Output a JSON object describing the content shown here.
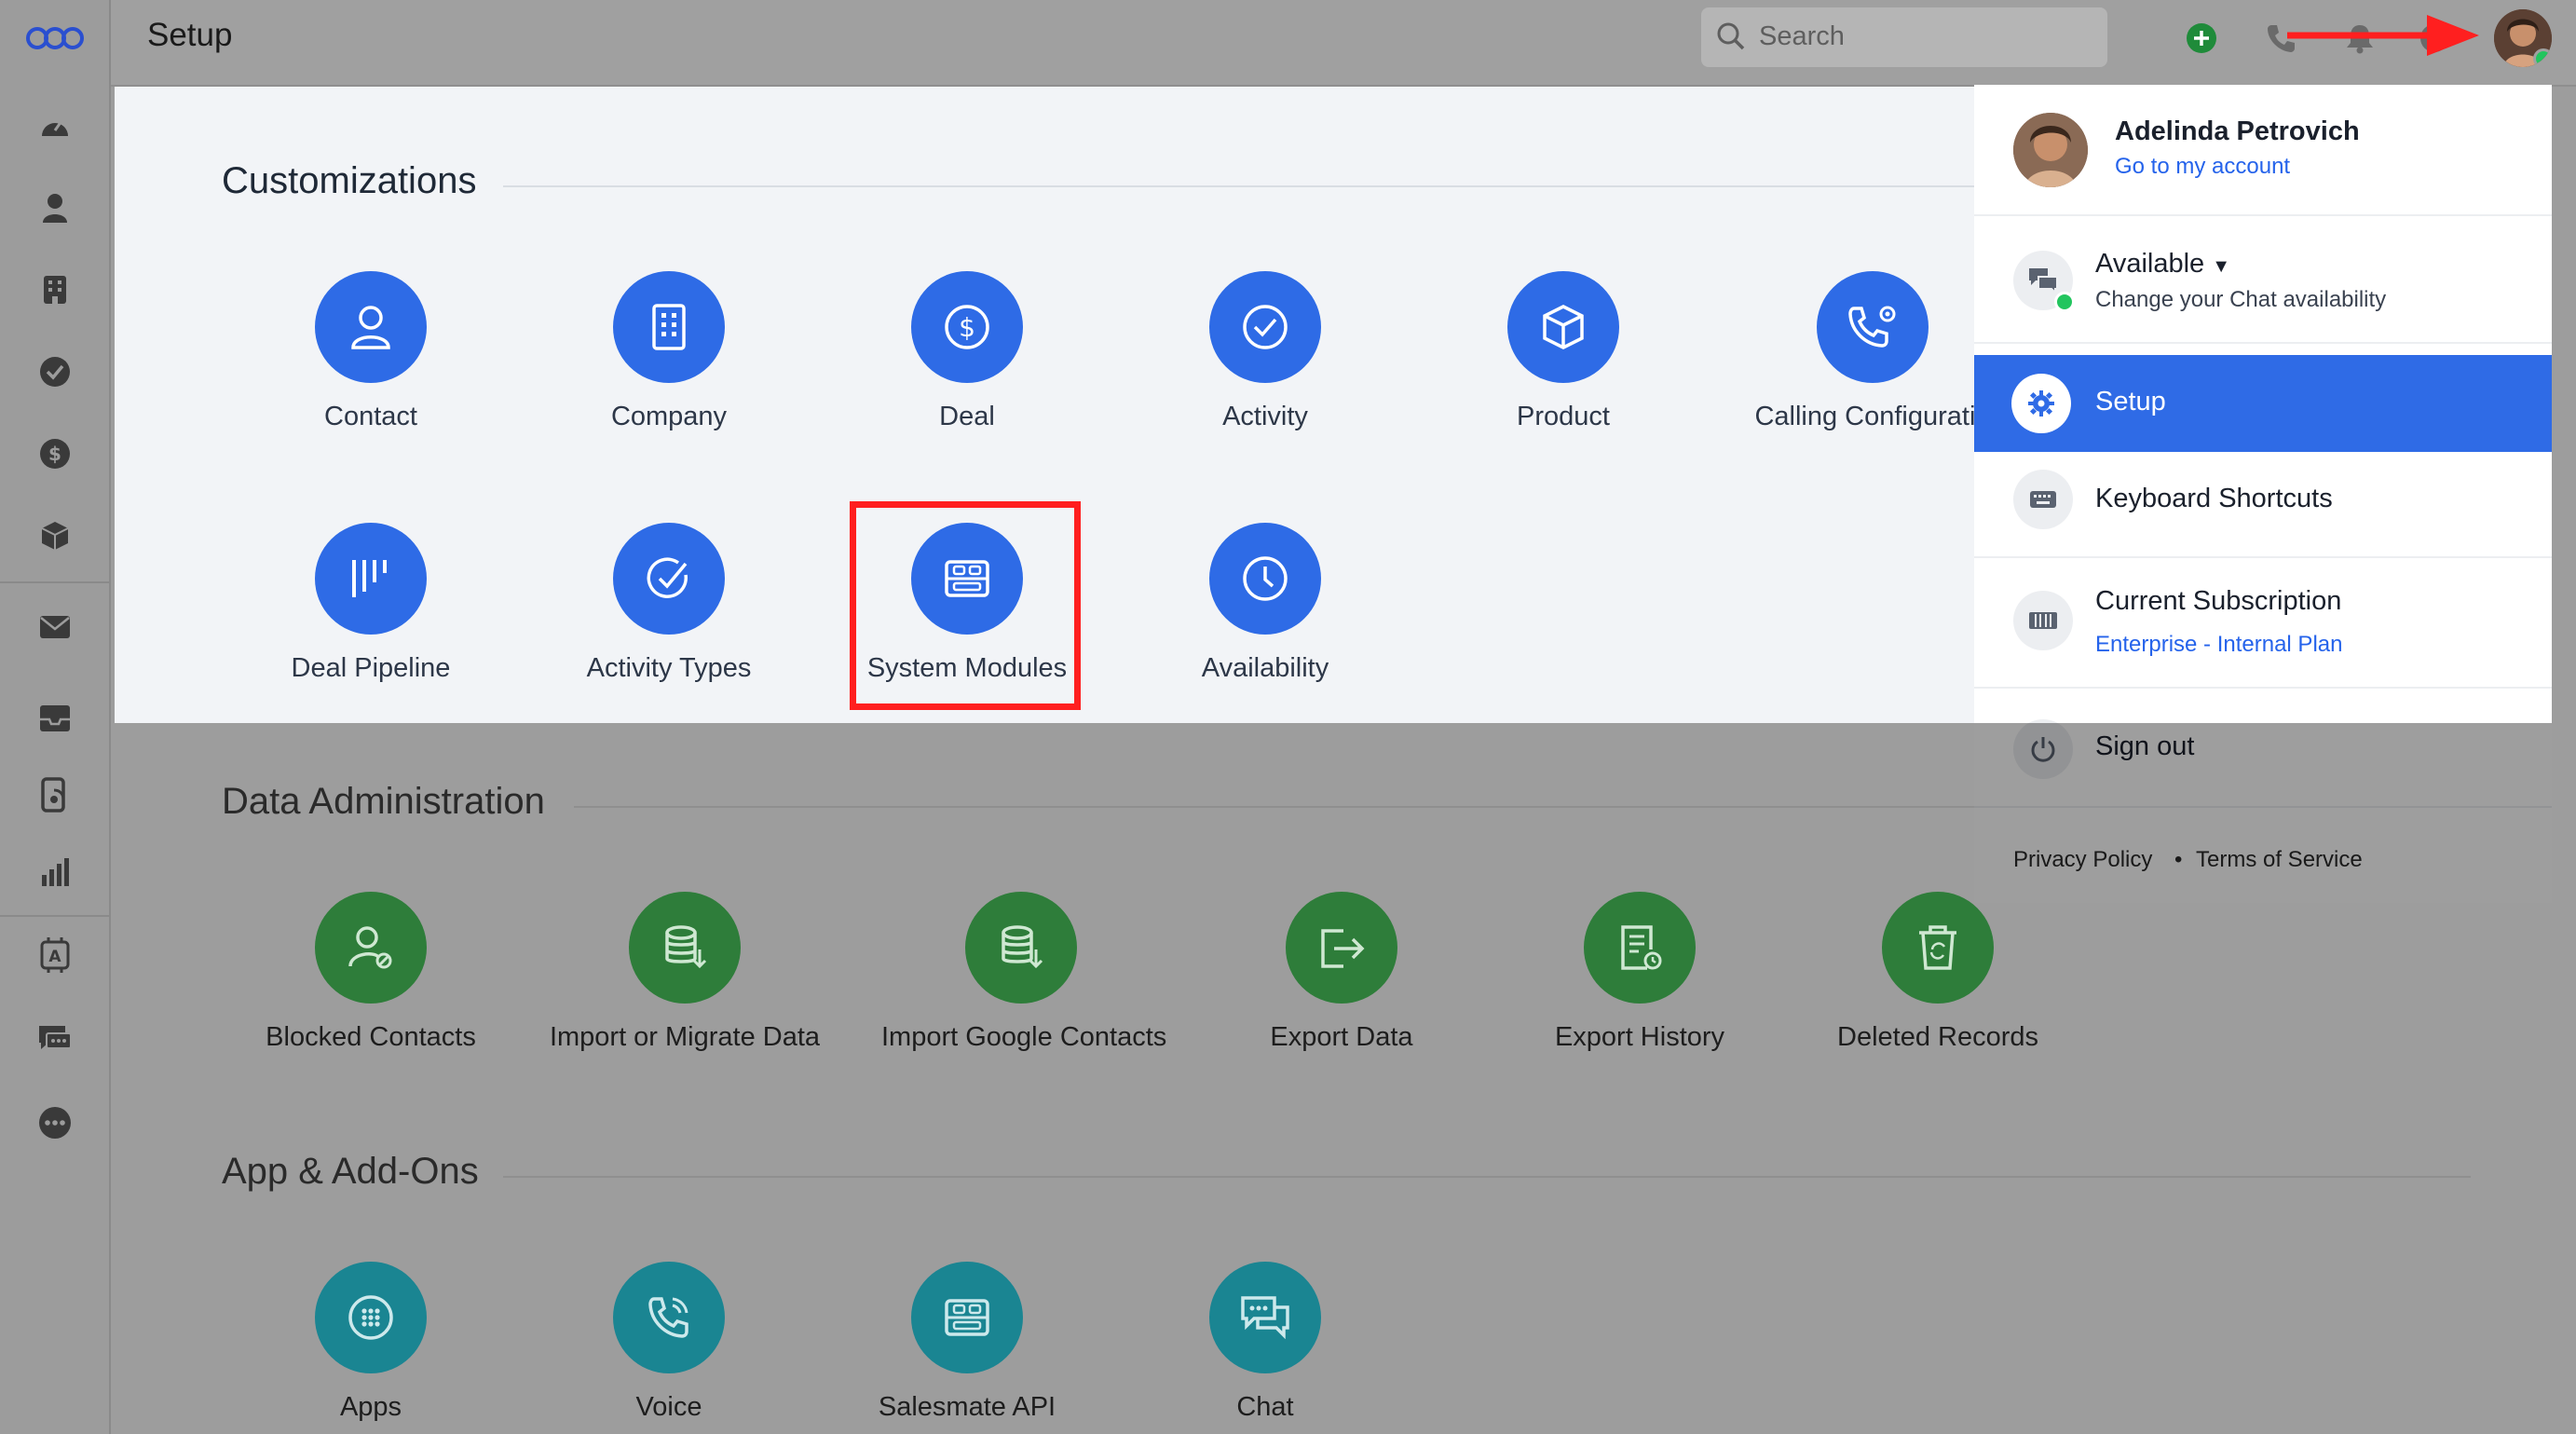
{
  "topbar": {
    "title": "Setup",
    "search_placeholder": "Search"
  },
  "sidebar": {
    "icons": [
      "logo-icon",
      "dashboard-icon",
      "contacts-icon",
      "companies-icon",
      "activities-icon",
      "deals-icon",
      "products-icon",
      "mail-icon",
      "inbox-icon",
      "dialer-icon",
      "reports-icon",
      "automation-icon",
      "chat-icon",
      "more-icon"
    ]
  },
  "sections": {
    "customizations": {
      "title": "Customizations",
      "items": [
        "Contact",
        "Company",
        "Deal",
        "Activity",
        "Product",
        "Calling Configuratio",
        "Deal Pipeline",
        "Activity Types",
        "System Modules",
        "Availability"
      ]
    },
    "data_admin": {
      "title": "Data Administration",
      "items": [
        "Blocked Contacts",
        "Import or Migrate Data",
        "Import Google Contacts",
        "Export Data",
        "Export History",
        "Deleted Records"
      ]
    },
    "apps": {
      "title": "App & Add-Ons",
      "items": [
        "Apps",
        "Voice",
        "Salesmate API",
        "Chat"
      ]
    }
  },
  "dropdown": {
    "user_name": "Adelinda Petrovich",
    "account_link": "Go to my account",
    "availability": "Available",
    "availability_sub": "Change your Chat availability",
    "setup": "Setup",
    "shortcuts": "Keyboard Shortcuts",
    "subscription": "Current Subscription",
    "plan": "Enterprise - Internal Plan",
    "signout": "Sign out",
    "privacy": "Privacy Policy",
    "terms": "Terms of Service",
    "separator": "•"
  },
  "colors": {
    "accent_blue": "#2e6be6",
    "data_green": "#2e7d3a",
    "apps_teal": "#1a8592",
    "highlight_red": "#ff1f1f"
  }
}
